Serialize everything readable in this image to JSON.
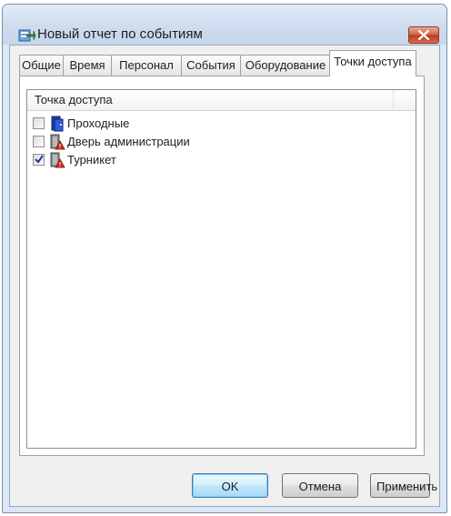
{
  "window": {
    "title": "Новый отчет по событиям",
    "icon": "report-icon",
    "close_icon": "close-icon"
  },
  "tabs": [
    {
      "label": "Общие",
      "active": false
    },
    {
      "label": "Время",
      "active": false
    },
    {
      "label": "Персонал",
      "active": false
    },
    {
      "label": "События",
      "active": false
    },
    {
      "label": "Оборудование",
      "active": false
    },
    {
      "label": "Точки доступа",
      "active": true
    }
  ],
  "list": {
    "column_header": "Точка доступа",
    "items": [
      {
        "label": "Проходные",
        "checked": false,
        "icon": "group-door-icon"
      },
      {
        "label": "Дверь администрации",
        "checked": false,
        "icon": "door-alarm-icon"
      },
      {
        "label": "Турникет",
        "checked": true,
        "icon": "turnstile-alarm-icon"
      }
    ]
  },
  "buttons": {
    "ok": "OK",
    "cancel": "Отмена",
    "apply": "Применить"
  },
  "colors": {
    "frame": "#dbe7f5",
    "close_button": "#c8452c",
    "default_button_border": "#3c7fb1"
  }
}
